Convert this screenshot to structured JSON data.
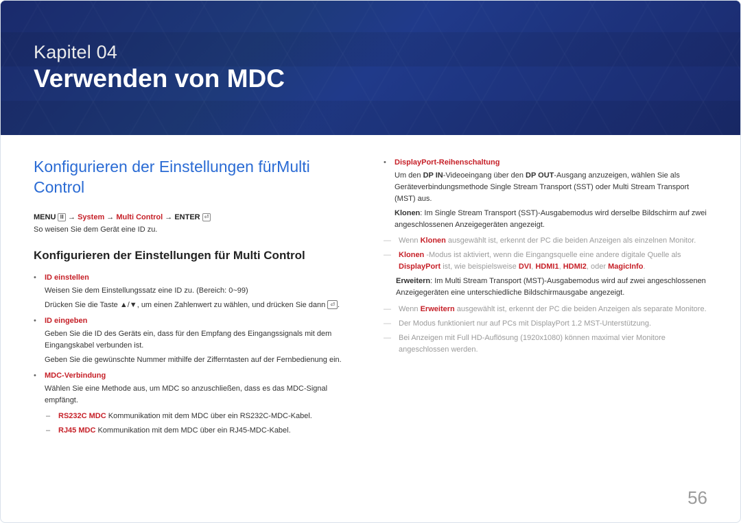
{
  "hero": {
    "chapter_label": "Kapitel 04",
    "chapter_title": "Verwenden von MDC"
  },
  "left": {
    "section_heading": "Konfigurieren der Einstellungen fürMulti Control",
    "menu_prefix": "MENU",
    "menu_icon1": "Ⅲ",
    "menu_arrow": " → ",
    "menu_system": "System",
    "menu_multi": "Multi Control",
    "menu_enter": "ENTER",
    "menu_icon2": "⏎",
    "intro": "So weisen Sie dem Gerät eine ID zu.",
    "sub_heading": "Konfigurieren der Einstellungen für Multi Control",
    "items": [
      {
        "title": "ID einstellen",
        "desc1": "Weisen Sie dem Einstellungssatz eine ID zu. (Bereich: 0~99)",
        "desc2_a": "Drücken Sie die Taste ",
        "desc2_b": "▲/▼",
        "desc2_c": ", um einen Zahlenwert zu wählen, und drücken Sie dann ",
        "desc2_icon": "⏎",
        "desc2_d": "."
      },
      {
        "title": "ID eingeben",
        "desc1": "Geben Sie die ID des Geräts ein, dass für den Empfang des Eingangssignals mit dem Eingangskabel verbunden ist.",
        "desc2": "Geben Sie die gewünschte Nummer mithilfe der Zifferntasten auf der Fernbedienung ein."
      },
      {
        "title": "MDC-Verbindung",
        "desc1": "Wählen Sie eine Methode aus, um MDC so anzuschließen, dass es das MDC-Signal empfängt.",
        "subs": [
          {
            "title": "RS232C MDC",
            "desc": "Kommunikation mit dem MDC über ein RS232C-MDC-Kabel."
          },
          {
            "title": "RJ45 MDC",
            "desc": "Kommunikation mit dem MDC über ein RJ45-MDC-Kabel."
          }
        ]
      }
    ]
  },
  "right": {
    "title": "DisplayPort-Reihenschaltung",
    "para1_a": "Um den ",
    "para1_b": "DP IN",
    "para1_c": "-Videoeingang über den ",
    "para1_d": "DP OUT",
    "para1_e": "-Ausgang anzuzeigen, wählen Sie als Geräteverbindungsmethode Single Stream Transport (SST) oder Multi Stream Transport (MST) aus.",
    "klonen_label": "Klonen",
    "klonen_desc": ": Im Single Stream Transport (SST)-Ausgabemodus wird derselbe Bildschirm auf zwei angeschlossenen Anzeigegeräten angezeigt.",
    "note1_a": "Wenn ",
    "note1_b": "Klonen",
    "note1_c": " ausgewählt ist, erkennt der PC die beiden Anzeigen als einzelnen Monitor.",
    "note2_a": "Klonen",
    "note2_b": " -Modus ist aktiviert, wenn die Eingangsquelle eine andere digitale Quelle als ",
    "note2_c": "DisplayPort",
    "note2_d": " ist, wie beispielsweise ",
    "note2_e": "DVI",
    "note2_f": ", ",
    "note2_g": "HDMI1",
    "note2_h": ", ",
    "note2_i": "HDMI2",
    "note2_j": ", oder ",
    "note2_k": "MagicInfo",
    "note2_l": ".",
    "erw_label": "Erweitern",
    "erw_desc": ": Im Multi Stream Transport (MST)-Ausgabemodus wird auf zwei angeschlossenen Anzeigegeräten eine unterschiedliche Bildschirmausgabe angezeigt.",
    "note3_a": "Wenn ",
    "note3_b": "Erweitern",
    "note3_c": " ausgewählt ist, erkennt der PC die beiden Anzeigen als separate Monitore.",
    "note4": "Der Modus funktioniert nur auf PCs mit DisplayPort 1.2 MST-Unterstützung.",
    "note5": "Bei Anzeigen mit Full HD-Auflösung (1920x1080) können maximal vier Monitore angeschlossen werden."
  },
  "page_number": "56"
}
